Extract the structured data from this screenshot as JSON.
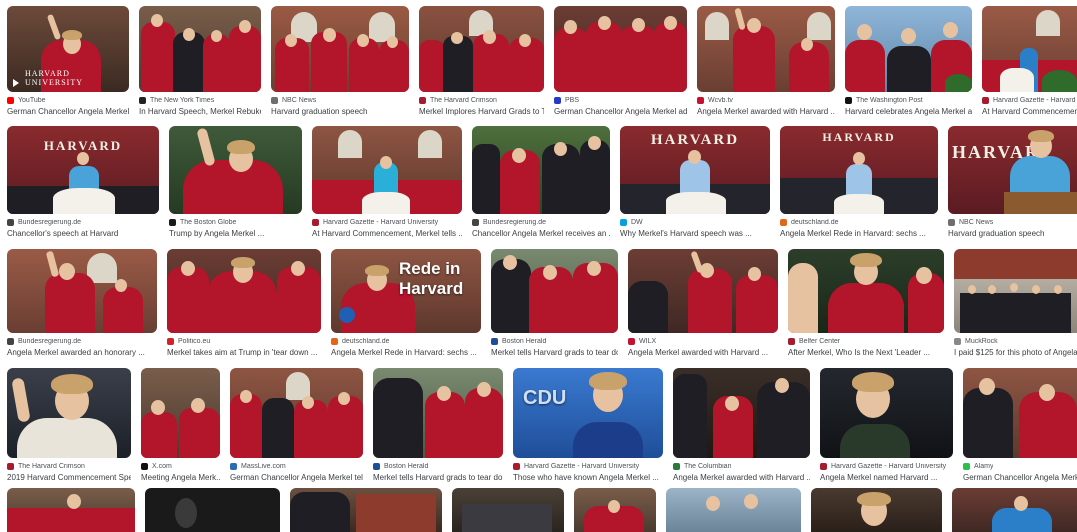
{
  "colors": {
    "robe_red": "#b3152b",
    "brick": "#8c3b2c",
    "sky": "#8fb6d8",
    "navy": "#1c3d8a"
  },
  "rows": [
    {
      "items": [
        {
          "source": "YouTube",
          "title": "German Chancellor Angela Merkel'...",
          "icon_color": "#ff0000",
          "icon": "youtube-icon",
          "overlay": "HARVARD UNIVERSITY"
        },
        {
          "source": "The New York Times",
          "title": "In Harvard Speech, Merkel Rebukes...",
          "icon_color": "#222222",
          "icon": "nyt-icon"
        },
        {
          "source": "NBC News",
          "title": "Harvard graduation speech",
          "icon_color": "#6e6e6e",
          "icon": "nbc-icon"
        },
        {
          "source": "The Harvard Crimson",
          "title": "Merkel Implores Harvard Grads to T...",
          "icon_color": "#a51c30",
          "icon": "crimson-icon"
        },
        {
          "source": "PBS",
          "title": "German Chancellor Angela Merkel ad...",
          "icon_color": "#2638c4",
          "icon": "pbs-icon"
        },
        {
          "source": "Wcvb.tv",
          "title": "Angela Merkel awarded with Harvard ...",
          "icon_color": "#c4122f",
          "icon": "wcvb-icon"
        },
        {
          "source": "The Washington Post",
          "title": "Harvard celebrates Angela Merkel as...",
          "icon_color": "#111111",
          "icon": "wapo-icon"
        },
        {
          "source": "Harvard Gazette - Harvard Univ",
          "title": "At Harvard Commencement, Me...",
          "icon_color": "#a51c30",
          "icon": "gazette-icon"
        }
      ]
    },
    {
      "items": [
        {
          "source": "Bundesregierung.de",
          "title": "Chancellor's speech at Harvard",
          "icon_color": "#444444",
          "icon": "bund-icon",
          "overlay": "HARVARD"
        },
        {
          "source": "The Boston Globe",
          "title": "Trump by Angela Merkel ...",
          "icon_color": "#1a1a1a",
          "icon": "globe-icon"
        },
        {
          "source": "Harvard Gazette - Harvard University",
          "title": "At Harvard Commencement, Merkel tells ...",
          "icon_color": "#a51c30",
          "icon": "gazette-icon"
        },
        {
          "source": "Bundesregierung.de",
          "title": "Chancellor Angela Merkel receives an ...",
          "icon_color": "#444444",
          "icon": "bund-icon"
        },
        {
          "source": "DW",
          "title": "Why Merkel's Harvard speech was ...",
          "icon_color": "#05a0e0",
          "icon": "dw-icon",
          "overlay": "HARVARD"
        },
        {
          "source": "deutschland.de",
          "title": "Angela Merkel Rede in Harvard: sechs ...",
          "icon_color": "#e2661a",
          "icon": "dde-icon",
          "overlay": "HARVARD"
        },
        {
          "source": "NBC News",
          "title": "Harvard graduation speech",
          "icon_color": "#6e6e6e",
          "icon": "nbc-icon",
          "overlay": "HARVAR"
        }
      ]
    },
    {
      "items": [
        {
          "source": "Bundesregierung.de",
          "title": "Angela Merkel awarded an honorary ...",
          "icon_color": "#444444",
          "icon": "bund-icon"
        },
        {
          "source": "Politico.eu",
          "title": "Merkel takes aim at Trump in 'tear down ...",
          "icon_color": "#d4202b",
          "icon": "politico-icon"
        },
        {
          "source": "deutschland.de",
          "title": "Angela Merkel Rede in Harvard: sechs ...",
          "icon_color": "#e2661a",
          "icon": "dde-icon",
          "overlay": "Rede in Harvard"
        },
        {
          "source": "Boston Herald",
          "title": "Merkel tells Harvard grads to tear do...",
          "icon_color": "#1f4e99",
          "icon": "herald-icon"
        },
        {
          "source": "WILX",
          "title": "Angela Merkel awarded with Harvard ...",
          "icon_color": "#c4122f",
          "icon": "wilx-icon"
        },
        {
          "source": "Belfer Center",
          "title": "After Merkel, Who Is the Next 'Leader ...",
          "icon_color": "#a51c30",
          "icon": "belfer-icon"
        },
        {
          "source": "MuckRock",
          "title": "I paid $125 for this photo of Angela ...",
          "icon_color": "#888888",
          "icon": "muckrock-icon"
        }
      ]
    },
    {
      "items": [
        {
          "source": "The Harvard Crimson",
          "title": "2019 Harvard Commencement Spe...",
          "icon_color": "#a51c30",
          "icon": "crimson-icon"
        },
        {
          "source": "X.com",
          "title": "Meeting Angela Merk...",
          "icon_color": "#111111",
          "icon": "x-icon"
        },
        {
          "source": "MassLive.com",
          "title": "German Chancellor Angela Merkel tells ...",
          "icon_color": "#2a6db5",
          "icon": "masslive-icon"
        },
        {
          "source": "Boston Herald",
          "title": "Merkel tells Harvard grads to tear do...",
          "icon_color": "#1f4e99",
          "icon": "herald-icon"
        },
        {
          "source": "Harvard Gazette - Harvard University",
          "title": "Those who have known Angela Merkel ...",
          "icon_color": "#a51c30",
          "icon": "gazette-icon",
          "overlay": "CDU"
        },
        {
          "source": "The Columbian",
          "title": "Angela Merkel awarded with Harvard ...",
          "icon_color": "#2a7a3a",
          "icon": "columbian-icon"
        },
        {
          "source": "Harvard Gazette - Harvard University",
          "title": "Angela Merkel named Harvard ...",
          "icon_color": "#a51c30",
          "icon": "gazette-icon"
        },
        {
          "source": "Alamy",
          "title": "German Chancellor Angela Merkel ...",
          "icon_color": "#2dbe4b",
          "icon": "alamy-icon"
        }
      ]
    }
  ]
}
